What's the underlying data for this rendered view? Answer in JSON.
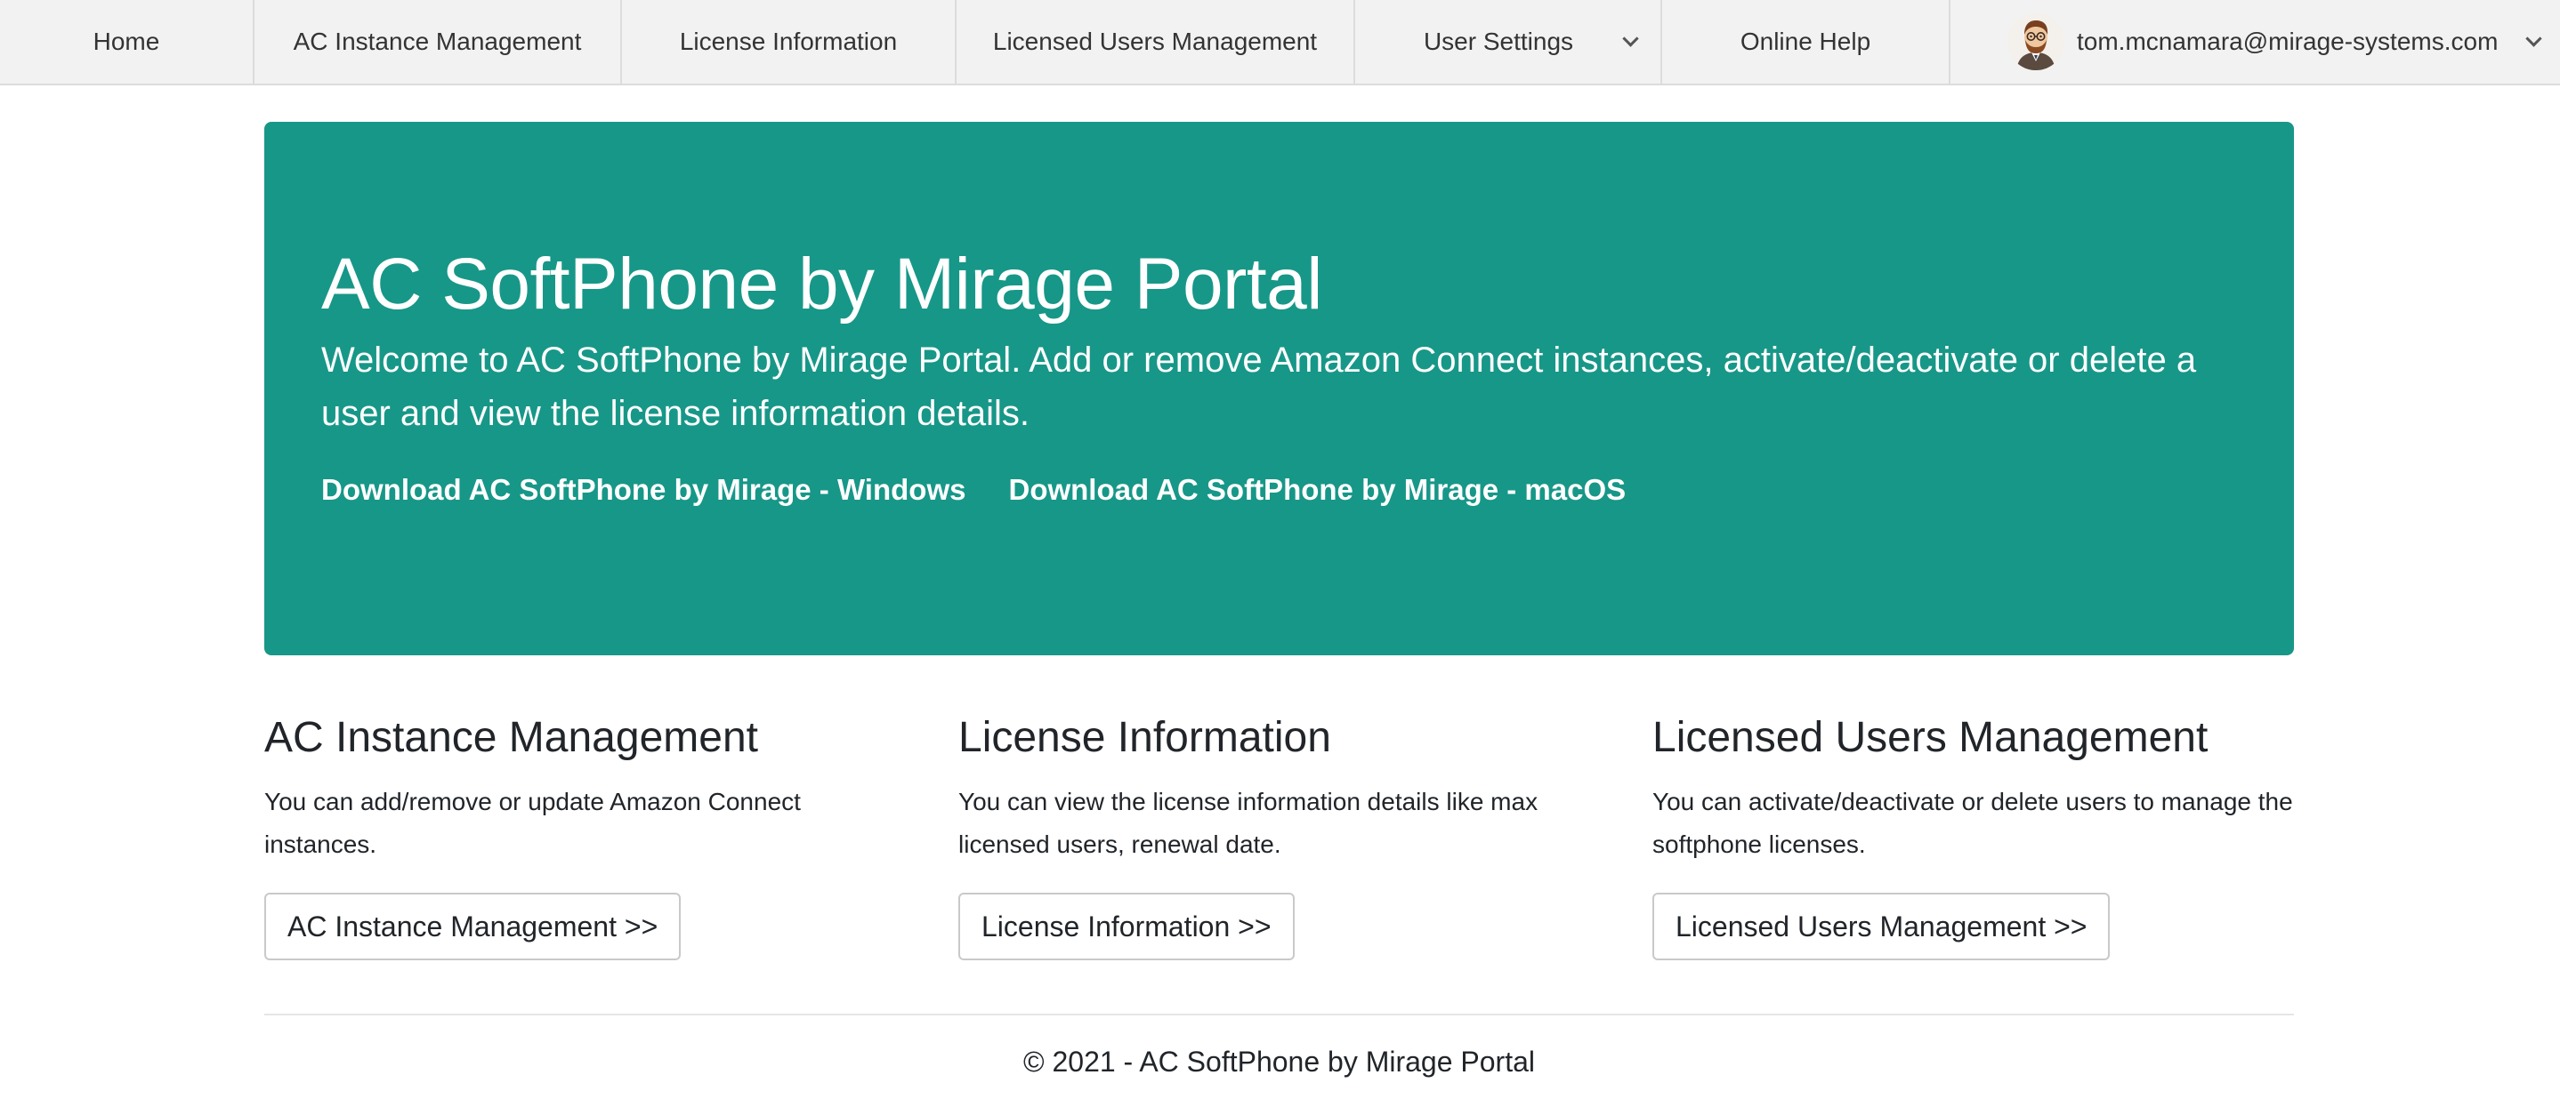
{
  "nav": {
    "home": "Home",
    "ac_instance": "AC Instance Management",
    "license_info": "License Information",
    "licensed_users": "Licensed Users Management",
    "user_settings": "User Settings",
    "online_help": "Online Help",
    "user_email": "tom.mcnamara@mirage-systems.com"
  },
  "hero": {
    "title": "AC SoftPhone by Mirage Portal",
    "text": "Welcome to AC SoftPhone by Mirage Portal. Add or remove Amazon Connect instances, activate/deactivate or delete a user and view the license information details.",
    "download_windows": "Download AC SoftPhone by Mirage - Windows",
    "download_macos": "Download AC SoftPhone by Mirage - macOS",
    "background_color": "#179788"
  },
  "cards": [
    {
      "title": "AC Instance Management",
      "text": "You can add/remove or update Amazon Connect instances.",
      "button": "AC Instance Management >>"
    },
    {
      "title": "License Information",
      "text": "You can view the license information details like max licensed users, renewal date.",
      "button": "License Information >>"
    },
    {
      "title": "Licensed Users Management",
      "text": "You can activate/deactivate or delete users to manage the softphone licenses.",
      "button": "Licensed Users Management >>"
    }
  ],
  "footer": {
    "text": "© 2021 - AC SoftPhone by Mirage Portal"
  }
}
